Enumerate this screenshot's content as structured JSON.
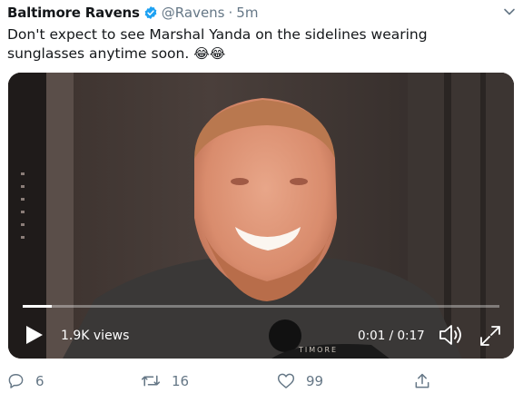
{
  "tweet": {
    "author_name": "Baltimore Ravens",
    "handle": "@Ravens",
    "separator": "·",
    "time": "5m",
    "text": "Don't expect to see Marshal Yanda on the sidelines wearing sunglasses anytime soon.",
    "emojis": "😂😂"
  },
  "video": {
    "views": "1.9K views",
    "timecode": "0:01 / 0:17",
    "progress": 0.06,
    "banner_text": "TIMORE"
  },
  "actions": {
    "replies": "6",
    "retweets": "16",
    "likes": "99"
  },
  "colors": {
    "text": "#14171a",
    "secondary": "#657786",
    "verified": "#1da1f2"
  }
}
